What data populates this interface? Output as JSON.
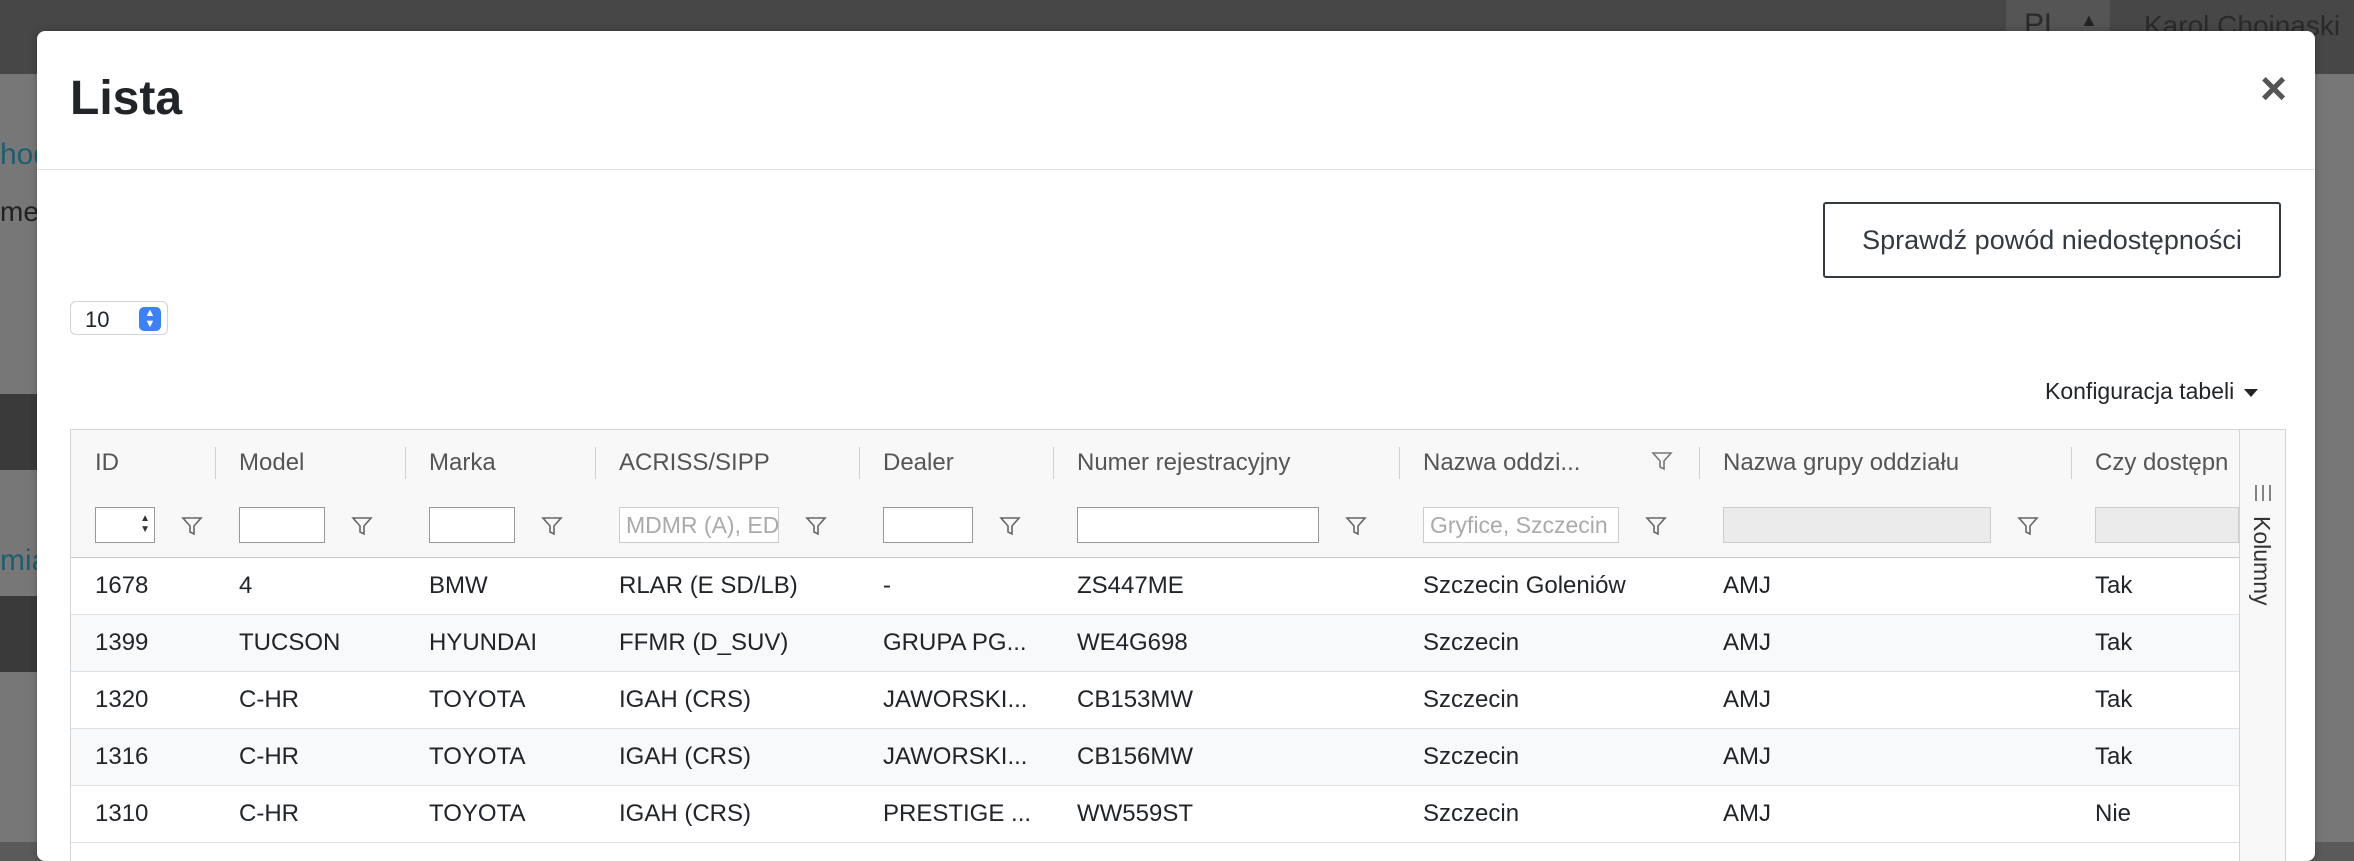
{
  "background": {
    "lang": "PL",
    "user": "Karol Chojnaski",
    "peek_1": "hod",
    "peek_2": "mer",
    "peek_3": "mia"
  },
  "modal": {
    "title": "Lista",
    "close": "×",
    "check_button": "Sprawdź powód niedostępności",
    "page_size": "10",
    "config_label": "Konfiguracja tabeli",
    "columns_panel": "Kolumny"
  },
  "table": {
    "headers": [
      "ID",
      "Model",
      "Marka",
      "ACRISS/SIPP",
      "Dealer",
      "Numer rejestracyjny",
      "Nazwa oddzi...",
      "Nazwa grupy oddziału",
      "Czy dostępn"
    ],
    "filters": {
      "acriss_placeholder": "MDMR (A), EDMR",
      "oddzial_placeholder": "Gryfice, Szczecin"
    },
    "rows": [
      [
        "1678",
        "4",
        "BMW",
        "RLAR (E SD/LB)",
        "-",
        "ZS447ME",
        "Szczecin Goleniów",
        "AMJ",
        "Tak"
      ],
      [
        "1399",
        "TUCSON",
        "HYUNDAI",
        "FFMR (D_SUV)",
        "GRUPA PG...",
        "WE4G698",
        "Szczecin",
        "AMJ",
        "Tak"
      ],
      [
        "1320",
        "C-HR",
        "TOYOTA",
        "IGAH (CRS)",
        "JAWORSKI...",
        "CB153MW",
        "Szczecin",
        "AMJ",
        "Tak"
      ],
      [
        "1316",
        "C-HR",
        "TOYOTA",
        "IGAH (CRS)",
        "JAWORSKI...",
        "CB156MW",
        "Szczecin",
        "AMJ",
        "Tak"
      ],
      [
        "1310",
        "C-HR",
        "TOYOTA",
        "IGAH (CRS)",
        "PRESTIGE ...",
        "WW559ST",
        "Szczecin",
        "AMJ",
        "Nie"
      ]
    ]
  },
  "colors": {
    "accent": "#3b82f6",
    "header_bg": "#f8f8f8",
    "row_alt_bg": "#f7f9fb"
  }
}
